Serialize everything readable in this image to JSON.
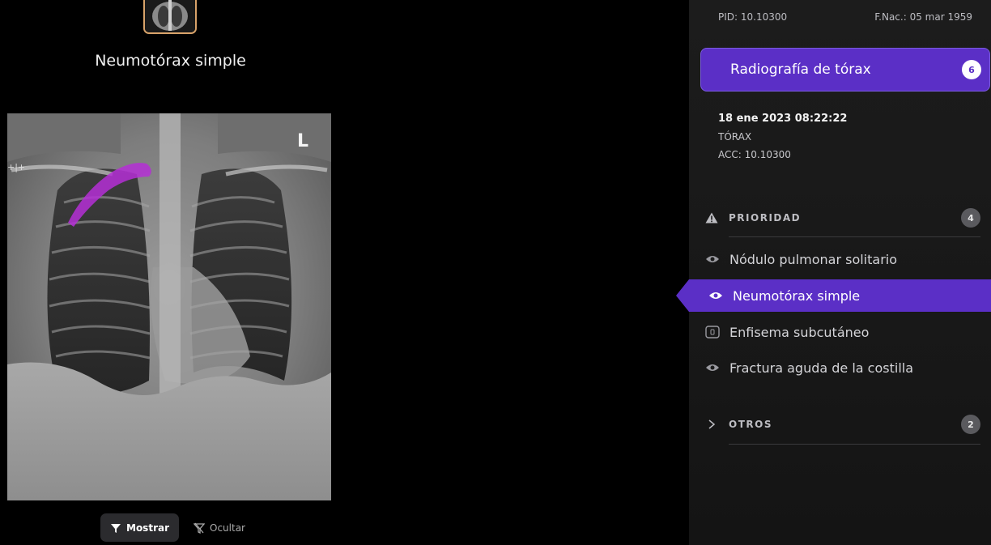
{
  "viewer": {
    "finding_title": "Neumotórax simple",
    "laterality_marker": "L",
    "ruler_mark": "+|+",
    "overlay_color": "#b52fd6",
    "toggle": {
      "show_label": "Mostrar",
      "hide_label": "Ocultar",
      "active": "Mostrar"
    }
  },
  "panel": {
    "patient": {
      "pid": "PID: 10.10300",
      "dob": "F.Nac.: 05 mar 1959"
    },
    "study": {
      "title": "Radiografía de tórax",
      "count": "6",
      "date": "18 ene 2023 08:22:22",
      "body_part": "TÓRAX",
      "acc": "ACC: 10.10300"
    },
    "priority": {
      "label": "PRIORIDAD",
      "count": "4",
      "items": [
        {
          "label": "Nódulo pulmonar solitario",
          "icon": "eye-icon"
        },
        {
          "label": "Neumotórax simple",
          "icon": "eye-icon"
        },
        {
          "label": "Enfisema subcutáneo",
          "icon": "box-icon"
        },
        {
          "label": "Fractura aguda de la costilla",
          "icon": "eye-icon"
        }
      ],
      "selected": "Neumotórax simple"
    },
    "others": {
      "label": "OTROS",
      "count": "2"
    },
    "accent_color": "#5b2fc6"
  }
}
